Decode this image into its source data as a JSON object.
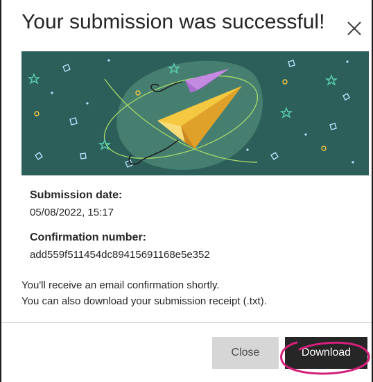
{
  "dialog": {
    "title": "Your submission was successful!",
    "close_icon": "close-icon"
  },
  "details": {
    "date_label": "Submission date:",
    "date_value": "05/08/2022, 15:17",
    "confirmation_label": "Confirmation number:",
    "confirmation_value": "add559f511454dc89415691168e5e352"
  },
  "notice": {
    "line1": "You'll receive an email confirmation shortly.",
    "line2": "You can also download your submission receipt (.txt)."
  },
  "footer": {
    "close_label": "Close",
    "download_label": "Download"
  },
  "colors": {
    "illustration_bg": "#2d5f5a",
    "paper_plane_yellow": "#f5c842",
    "paper_plane_purple": "#c48ae0",
    "annotation": "#d4207a",
    "primary_button": "#262626",
    "secondary_button": "#d6d6d6"
  }
}
